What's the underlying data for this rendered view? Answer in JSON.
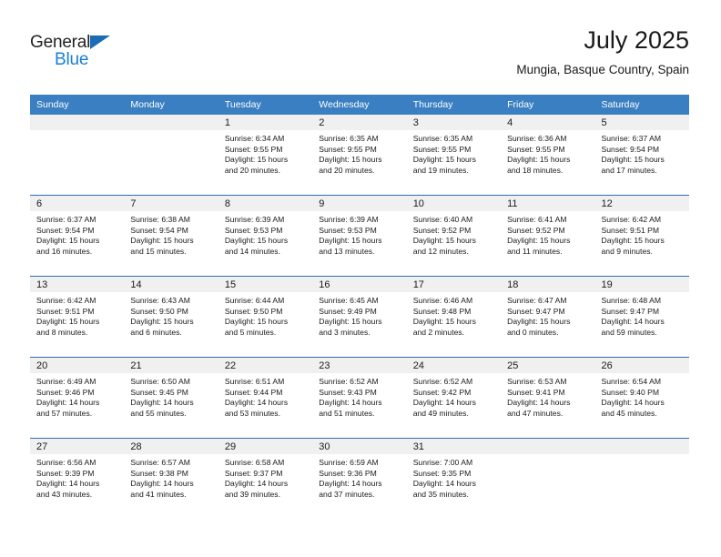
{
  "brand": {
    "name_part1": "General",
    "name_part2": "Blue",
    "triangle_color": "#1a6cb5",
    "blue_color": "#1a7fd4"
  },
  "header": {
    "title": "July 2025",
    "subtitle": "Mungia, Basque Country, Spain"
  },
  "theme": {
    "header_blue": "#3a7fc1",
    "row_divider_blue": "#2c6fb5",
    "daynum_band_gray": "#f0f0f0"
  },
  "weekday_headers": [
    "Sunday",
    "Monday",
    "Tuesday",
    "Wednesday",
    "Thursday",
    "Friday",
    "Saturday"
  ],
  "weeks": [
    [
      {
        "day": "",
        "empty": true
      },
      {
        "day": "",
        "empty": true
      },
      {
        "day": "1",
        "sunrise": "Sunrise: 6:34 AM",
        "sunset": "Sunset: 9:55 PM",
        "daylight1": "Daylight: 15 hours",
        "daylight2": "and 20 minutes."
      },
      {
        "day": "2",
        "sunrise": "Sunrise: 6:35 AM",
        "sunset": "Sunset: 9:55 PM",
        "daylight1": "Daylight: 15 hours",
        "daylight2": "and 20 minutes."
      },
      {
        "day": "3",
        "sunrise": "Sunrise: 6:35 AM",
        "sunset": "Sunset: 9:55 PM",
        "daylight1": "Daylight: 15 hours",
        "daylight2": "and 19 minutes."
      },
      {
        "day": "4",
        "sunrise": "Sunrise: 6:36 AM",
        "sunset": "Sunset: 9:55 PM",
        "daylight1": "Daylight: 15 hours",
        "daylight2": "and 18 minutes."
      },
      {
        "day": "5",
        "sunrise": "Sunrise: 6:37 AM",
        "sunset": "Sunset: 9:54 PM",
        "daylight1": "Daylight: 15 hours",
        "daylight2": "and 17 minutes."
      }
    ],
    [
      {
        "day": "6",
        "sunrise": "Sunrise: 6:37 AM",
        "sunset": "Sunset: 9:54 PM",
        "daylight1": "Daylight: 15 hours",
        "daylight2": "and 16 minutes."
      },
      {
        "day": "7",
        "sunrise": "Sunrise: 6:38 AM",
        "sunset": "Sunset: 9:54 PM",
        "daylight1": "Daylight: 15 hours",
        "daylight2": "and 15 minutes."
      },
      {
        "day": "8",
        "sunrise": "Sunrise: 6:39 AM",
        "sunset": "Sunset: 9:53 PM",
        "daylight1": "Daylight: 15 hours",
        "daylight2": "and 14 minutes."
      },
      {
        "day": "9",
        "sunrise": "Sunrise: 6:39 AM",
        "sunset": "Sunset: 9:53 PM",
        "daylight1": "Daylight: 15 hours",
        "daylight2": "and 13 minutes."
      },
      {
        "day": "10",
        "sunrise": "Sunrise: 6:40 AM",
        "sunset": "Sunset: 9:52 PM",
        "daylight1": "Daylight: 15 hours",
        "daylight2": "and 12 minutes."
      },
      {
        "day": "11",
        "sunrise": "Sunrise: 6:41 AM",
        "sunset": "Sunset: 9:52 PM",
        "daylight1": "Daylight: 15 hours",
        "daylight2": "and 11 minutes."
      },
      {
        "day": "12",
        "sunrise": "Sunrise: 6:42 AM",
        "sunset": "Sunset: 9:51 PM",
        "daylight1": "Daylight: 15 hours",
        "daylight2": "and 9 minutes."
      }
    ],
    [
      {
        "day": "13",
        "sunrise": "Sunrise: 6:42 AM",
        "sunset": "Sunset: 9:51 PM",
        "daylight1": "Daylight: 15 hours",
        "daylight2": "and 8 minutes."
      },
      {
        "day": "14",
        "sunrise": "Sunrise: 6:43 AM",
        "sunset": "Sunset: 9:50 PM",
        "daylight1": "Daylight: 15 hours",
        "daylight2": "and 6 minutes."
      },
      {
        "day": "15",
        "sunrise": "Sunrise: 6:44 AM",
        "sunset": "Sunset: 9:50 PM",
        "daylight1": "Daylight: 15 hours",
        "daylight2": "and 5 minutes."
      },
      {
        "day": "16",
        "sunrise": "Sunrise: 6:45 AM",
        "sunset": "Sunset: 9:49 PM",
        "daylight1": "Daylight: 15 hours",
        "daylight2": "and 3 minutes."
      },
      {
        "day": "17",
        "sunrise": "Sunrise: 6:46 AM",
        "sunset": "Sunset: 9:48 PM",
        "daylight1": "Daylight: 15 hours",
        "daylight2": "and 2 minutes."
      },
      {
        "day": "18",
        "sunrise": "Sunrise: 6:47 AM",
        "sunset": "Sunset: 9:47 PM",
        "daylight1": "Daylight: 15 hours",
        "daylight2": "and 0 minutes."
      },
      {
        "day": "19",
        "sunrise": "Sunrise: 6:48 AM",
        "sunset": "Sunset: 9:47 PM",
        "daylight1": "Daylight: 14 hours",
        "daylight2": "and 59 minutes."
      }
    ],
    [
      {
        "day": "20",
        "sunrise": "Sunrise: 6:49 AM",
        "sunset": "Sunset: 9:46 PM",
        "daylight1": "Daylight: 14 hours",
        "daylight2": "and 57 minutes."
      },
      {
        "day": "21",
        "sunrise": "Sunrise: 6:50 AM",
        "sunset": "Sunset: 9:45 PM",
        "daylight1": "Daylight: 14 hours",
        "daylight2": "and 55 minutes."
      },
      {
        "day": "22",
        "sunrise": "Sunrise: 6:51 AM",
        "sunset": "Sunset: 9:44 PM",
        "daylight1": "Daylight: 14 hours",
        "daylight2": "and 53 minutes."
      },
      {
        "day": "23",
        "sunrise": "Sunrise: 6:52 AM",
        "sunset": "Sunset: 9:43 PM",
        "daylight1": "Daylight: 14 hours",
        "daylight2": "and 51 minutes."
      },
      {
        "day": "24",
        "sunrise": "Sunrise: 6:52 AM",
        "sunset": "Sunset: 9:42 PM",
        "daylight1": "Daylight: 14 hours",
        "daylight2": "and 49 minutes."
      },
      {
        "day": "25",
        "sunrise": "Sunrise: 6:53 AM",
        "sunset": "Sunset: 9:41 PM",
        "daylight1": "Daylight: 14 hours",
        "daylight2": "and 47 minutes."
      },
      {
        "day": "26",
        "sunrise": "Sunrise: 6:54 AM",
        "sunset": "Sunset: 9:40 PM",
        "daylight1": "Daylight: 14 hours",
        "daylight2": "and 45 minutes."
      }
    ],
    [
      {
        "day": "27",
        "sunrise": "Sunrise: 6:56 AM",
        "sunset": "Sunset: 9:39 PM",
        "daylight1": "Daylight: 14 hours",
        "daylight2": "and 43 minutes."
      },
      {
        "day": "28",
        "sunrise": "Sunrise: 6:57 AM",
        "sunset": "Sunset: 9:38 PM",
        "daylight1": "Daylight: 14 hours",
        "daylight2": "and 41 minutes."
      },
      {
        "day": "29",
        "sunrise": "Sunrise: 6:58 AM",
        "sunset": "Sunset: 9:37 PM",
        "daylight1": "Daylight: 14 hours",
        "daylight2": "and 39 minutes."
      },
      {
        "day": "30",
        "sunrise": "Sunrise: 6:59 AM",
        "sunset": "Sunset: 9:36 PM",
        "daylight1": "Daylight: 14 hours",
        "daylight2": "and 37 minutes."
      },
      {
        "day": "31",
        "sunrise": "Sunrise: 7:00 AM",
        "sunset": "Sunset: 9:35 PM",
        "daylight1": "Daylight: 14 hours",
        "daylight2": "and 35 minutes."
      },
      {
        "day": "",
        "empty": true
      },
      {
        "day": "",
        "empty": true
      }
    ]
  ]
}
